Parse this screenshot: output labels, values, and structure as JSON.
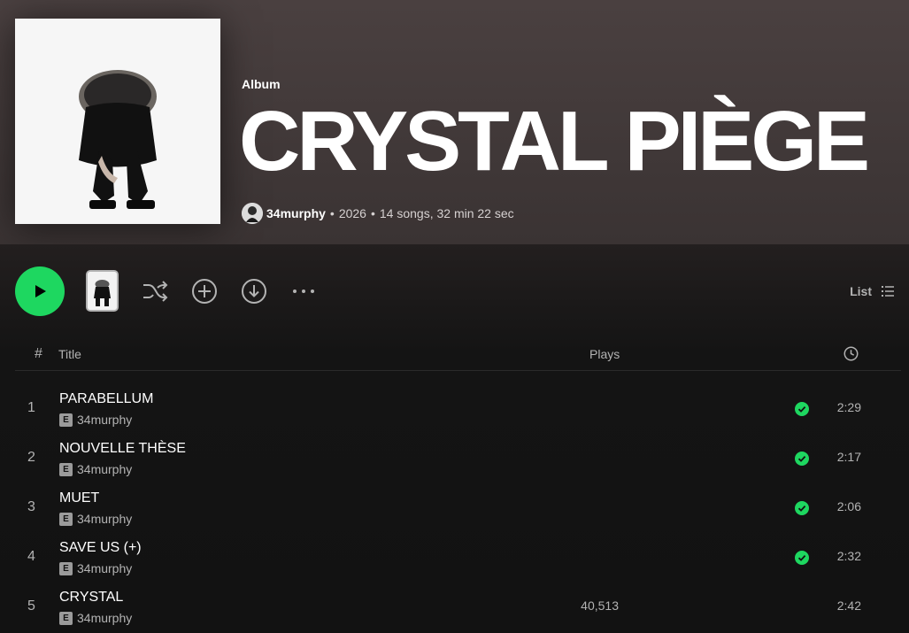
{
  "album": {
    "type": "Album",
    "title": "CRYSTAL PIÈGE",
    "artist": "34murphy",
    "year": "2026",
    "summary": "14 songs, 32 min 22 sec",
    "separator": "•"
  },
  "controls": {
    "play_icon": "play-icon",
    "shuffle_icon": "shuffle-icon",
    "add_icon": "add-circle-icon",
    "download_icon": "download-icon",
    "more_icon": "more-options-icon",
    "view_label": "List",
    "view_icon": "list-icon"
  },
  "table": {
    "headers": {
      "number": "#",
      "title": "Title",
      "plays": "Plays",
      "duration_icon": "clock-icon"
    },
    "rows": [
      {
        "number": "1",
        "title": "PARABELLUM",
        "explicit": "E",
        "artist": "34murphy",
        "plays": "",
        "saved": true,
        "duration": "2:29"
      },
      {
        "number": "2",
        "title": "NOUVELLE THÈSE",
        "explicit": "E",
        "artist": "34murphy",
        "plays": "",
        "saved": true,
        "duration": "2:17"
      },
      {
        "number": "3",
        "title": "MUET",
        "explicit": "E",
        "artist": "34murphy",
        "plays": "",
        "saved": true,
        "duration": "2:06"
      },
      {
        "number": "4",
        "title": "SAVE US (+)",
        "explicit": "E",
        "artist": "34murphy",
        "plays": "",
        "saved": true,
        "duration": "2:32"
      },
      {
        "number": "5",
        "title": "CRYSTAL",
        "explicit": "E",
        "artist": "34murphy",
        "plays": "40,513",
        "saved": false,
        "duration": "2:42"
      }
    ]
  },
  "colors": {
    "accent": "#1ed760",
    "header_bg": "#4a4040",
    "body_bg": "#121212",
    "muted_text": "#b3b3b3"
  }
}
